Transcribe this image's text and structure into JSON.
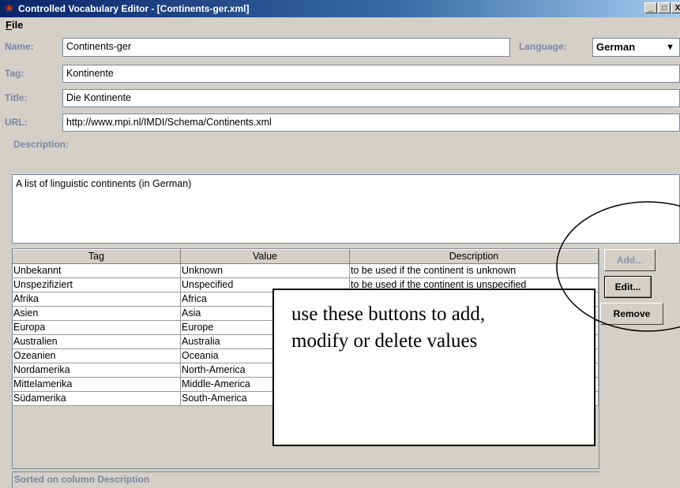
{
  "window": {
    "title": "Controlled Vocabulary Editor - [Continents-ger.xml]",
    "app_icon": "vocabulary-app-icon",
    "buttons": {
      "minimize": "_",
      "maximize": "□",
      "close": "X"
    }
  },
  "menu": {
    "file": "File"
  },
  "form": {
    "name_label": "Name:",
    "name_value": "Continents-ger",
    "language_label": "Language:",
    "language_value": "German",
    "tag_label": "Tag:",
    "tag_value": "Kontinente",
    "title_label": "Title:",
    "title_value": "Die Kontinente",
    "url_label": "URL:",
    "url_value": "http://www.mpi.nl/IMDI/Schema/Continents.xml",
    "description_label": "Description:",
    "description_value": "A list of linguistic continents (in German)"
  },
  "table": {
    "columns": [
      "Tag",
      "Value",
      "Description"
    ],
    "rows": [
      [
        "Unbekannt",
        "Unknown",
        "to be used if the continent is unknown"
      ],
      [
        "Unspezifiziert",
        "Unspecified",
        "to be used if the continent is unspecified"
      ],
      [
        "Afrika",
        "Africa",
        ""
      ],
      [
        "Asien",
        "Asia",
        ""
      ],
      [
        "Europa",
        "Europe",
        ""
      ],
      [
        "Australien",
        "Australia",
        ""
      ],
      [
        "Ozeanien",
        "Oceania",
        ""
      ],
      [
        "Nordamerika",
        "North-America",
        ""
      ],
      [
        "Mittelamerika",
        "Middle-America",
        ""
      ],
      [
        "Südamerika",
        "South-America",
        ""
      ]
    ],
    "status": "Sorted on column Description"
  },
  "buttons": {
    "add": "Add...",
    "edit": "Edit...",
    "remove": "Remove"
  },
  "callout": {
    "line1": "use these buttons to add,",
    "line2": "modify or delete values"
  },
  "colors": {
    "label": "#7b86a6",
    "titlebar": "#0a246a",
    "panel": "#d4d0c8",
    "disabled": "#8c96a8"
  }
}
